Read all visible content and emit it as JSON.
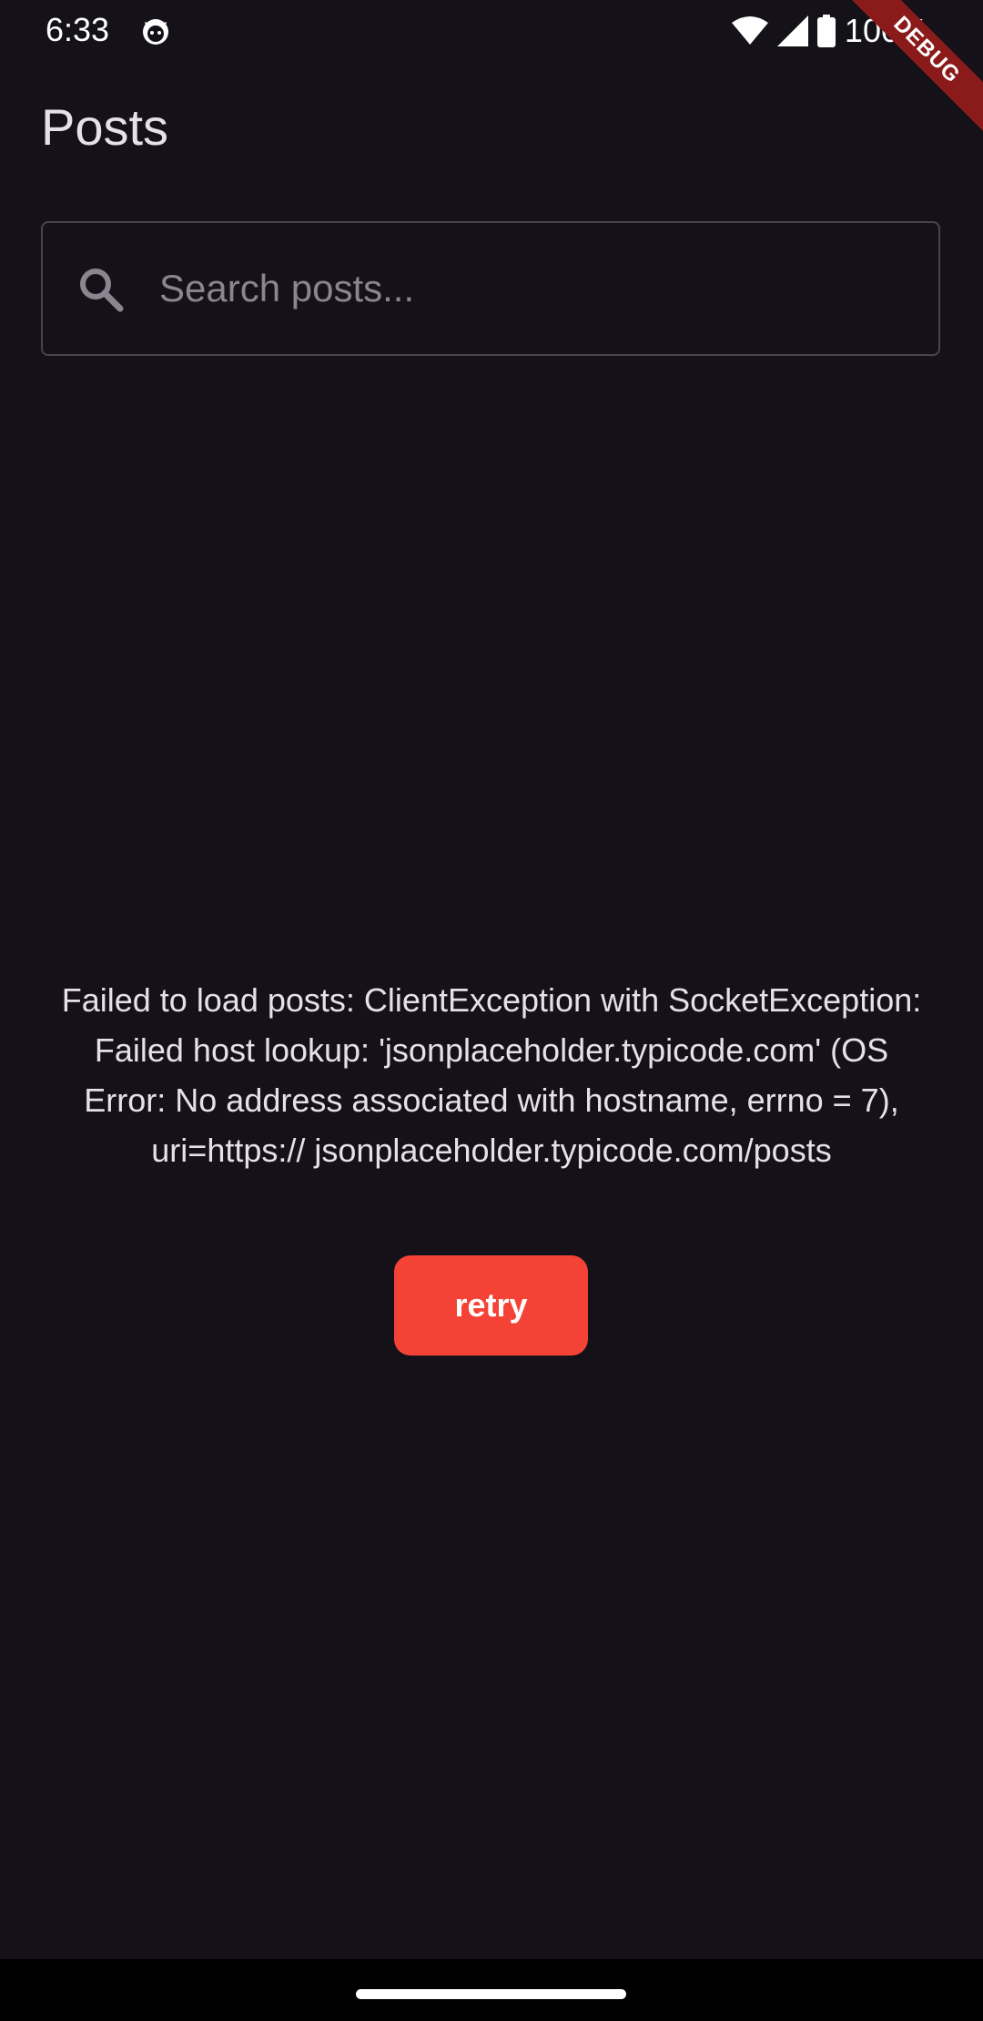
{
  "status_bar": {
    "time": "6:33",
    "battery": "100%",
    "app_icon": "cat-face-icon",
    "wifi_icon": "wifi-icon",
    "signal_icon": "cell-signal-icon",
    "battery_icon": "battery-full-icon"
  },
  "debug_banner": {
    "label": "DEBUG"
  },
  "app_bar": {
    "title": "Posts"
  },
  "search": {
    "placeholder": "Search posts...",
    "value": "",
    "icon": "search-icon"
  },
  "error": {
    "message": "Failed to load posts: ClientException with SocketException: Failed host lookup: 'jsonplaceholder.typicode.com' (OS Error: No address associated with hostname, errno = 7), uri=https:// jsonplaceholder.typicode.com/posts"
  },
  "retry_button": {
    "label": "retry"
  },
  "colors": {
    "background": "#141218",
    "accent": "#f44336",
    "debug_banner": "#8b1a1a",
    "nav_bar": "#000000"
  }
}
